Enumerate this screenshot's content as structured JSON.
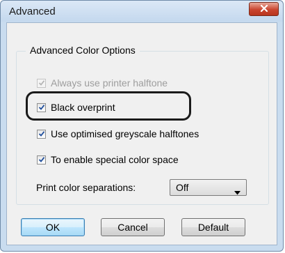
{
  "window": {
    "title": "Advanced",
    "close_icon": "close-icon",
    "close_color": "#c9452f"
  },
  "group": {
    "legend": "Advanced Color Options"
  },
  "options": [
    {
      "label": "Always use printer halftone",
      "checked": true,
      "enabled": false
    },
    {
      "label": "Black overprint",
      "checked": true,
      "enabled": true,
      "highlighted": true
    },
    {
      "label": "Use optimised greyscale halftones",
      "checked": true,
      "enabled": true
    },
    {
      "label": "To enable special color space",
      "checked": true,
      "enabled": true
    }
  ],
  "separations": {
    "label": "Print color separations:",
    "value": "Off"
  },
  "buttons": {
    "ok": "OK",
    "cancel": "Cancel",
    "default": "Default"
  }
}
